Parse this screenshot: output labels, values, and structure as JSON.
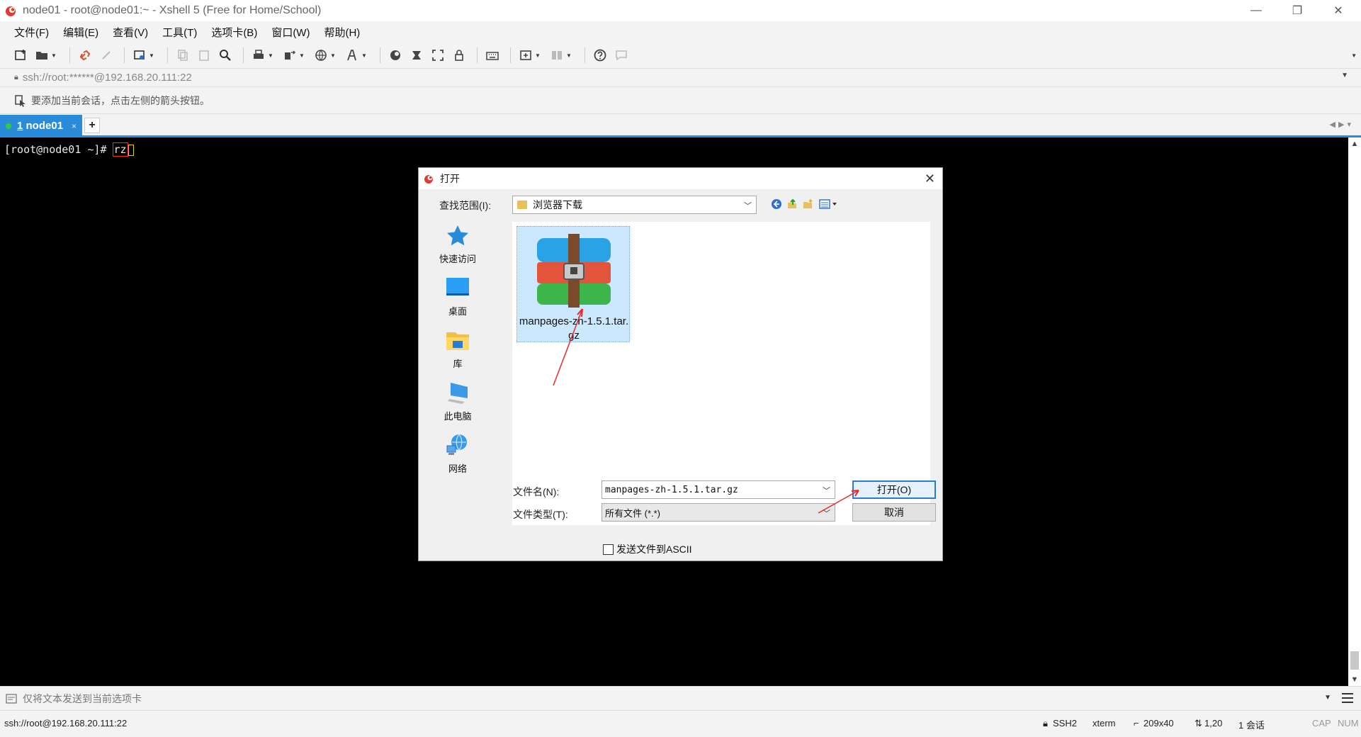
{
  "window": {
    "title": "node01 - root@node01:~ - Xshell 5 (Free for Home/School)",
    "minimize": "—",
    "restore": "❐",
    "close": "✕"
  },
  "menu": [
    "文件(F)",
    "编辑(E)",
    "查看(V)",
    "工具(T)",
    "选项卡(B)",
    "窗口(W)",
    "帮助(H)"
  ],
  "address": {
    "url": "ssh://root:******@192.168.20.111:22"
  },
  "tip": {
    "text": "要添加当前会话，点击左侧的箭头按钮。"
  },
  "tabs": [
    {
      "number": "1",
      "label": "node01",
      "close": "×",
      "active": true
    }
  ],
  "terminal": {
    "prompt": "[root@node01 ~]# ",
    "command": "rz"
  },
  "dialog": {
    "title": "打开",
    "look_in_label": "查找范围(I):",
    "look_in_value": "浏览器下载",
    "places": [
      {
        "label": "快速访问",
        "icon": "star-icon"
      },
      {
        "label": "桌面",
        "icon": "desktop-icon"
      },
      {
        "label": "库",
        "icon": "library-icon"
      },
      {
        "label": "此电脑",
        "icon": "computer-icon"
      },
      {
        "label": "网络",
        "icon": "network-icon"
      }
    ],
    "file": {
      "name": "manpages-zh-1.5.1.tar.gz",
      "icon": "archive-icon"
    },
    "filename_label": "文件名(N):",
    "filename_value": "manpages-zh-1.5.1.tar.gz",
    "filetype_label": "文件类型(T):",
    "filetype_value": "所有文件 (*.*)",
    "open_button": "打开(O)",
    "cancel_button": "取消",
    "ascii_label": "发送文件到ASCII",
    "ascii_checked": false
  },
  "sendbar": {
    "text": "仅将文本发送到当前选项卡"
  },
  "status": {
    "connection": "ssh://root@192.168.20.111:22",
    "protocol": "SSH2",
    "terminal": "xterm",
    "size": "209x40",
    "position": "1,20",
    "sessions": "1 会话",
    "cap": "CAP",
    "num": "NUM"
  },
  "colors": {
    "accent": "#2a8cd8",
    "annotation": "#e8282a",
    "selection": "#cce8ff"
  }
}
